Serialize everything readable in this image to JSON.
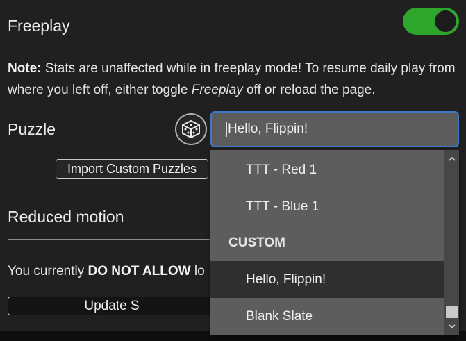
{
  "freeplay": {
    "label": "Freeplay",
    "enabled": true,
    "toggle_color": "#2ea62b"
  },
  "note": {
    "bold": "Note:",
    "text_before_italic": " Stats are unaffected while in freeplay mode! To resume daily play from where you left off, either toggle ",
    "italic": "Freeplay",
    "text_after_italic": " off or reload the page."
  },
  "puzzle": {
    "label": "Puzzle",
    "dice_icon": "dice-icon",
    "input_value": "Hello, Flippin!",
    "focus_color": "#3e78c8"
  },
  "import_button": {
    "label": "Import Custom Puzzles"
  },
  "reduced_motion": {
    "label": "Reduced motion"
  },
  "allow_status": {
    "prefix": "You currently ",
    "bold": "DO NOT ALLOW",
    "suffix": " lo"
  },
  "update_button": {
    "label": "Update S"
  },
  "dropdown": {
    "items": [
      {
        "type": "option",
        "label": "TTT - Red 1"
      },
      {
        "type": "option",
        "label": "TTT - Blue 1"
      },
      {
        "type": "group",
        "label": "CUSTOM"
      },
      {
        "type": "option",
        "label": "Hello, Flippin!",
        "selected": true
      },
      {
        "type": "option",
        "label": "Blank Slate"
      }
    ]
  }
}
